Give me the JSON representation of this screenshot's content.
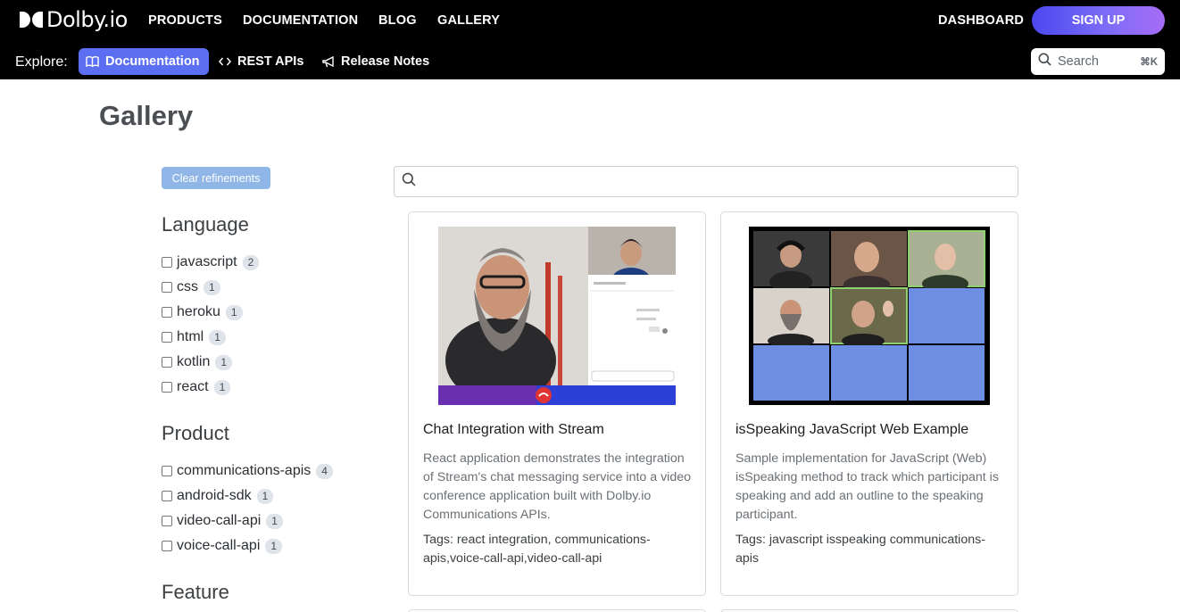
{
  "brand": {
    "name": "Dolby.io"
  },
  "topnav": {
    "links": [
      {
        "label": "PRODUCTS"
      },
      {
        "label": "DOCUMENTATION"
      },
      {
        "label": "BLOG"
      },
      {
        "label": "GALLERY"
      }
    ],
    "dashboard": "DASHBOARD",
    "signup": "SIGN UP"
  },
  "subnav": {
    "explore_label": "Explore:",
    "items": [
      {
        "label": "Documentation",
        "icon": "book-icon"
      },
      {
        "label": "REST APIs",
        "icon": "code-icon"
      },
      {
        "label": "Release Notes",
        "icon": "megaphone-icon"
      }
    ],
    "search": {
      "label": "Search",
      "shortcut": "⌘K"
    }
  },
  "page": {
    "title": "Gallery"
  },
  "filters": {
    "clear_label": "Clear refinements",
    "facets": [
      {
        "title": "Language",
        "items": [
          {
            "label": "javascript",
            "count": "2"
          },
          {
            "label": "css",
            "count": "1"
          },
          {
            "label": "heroku",
            "count": "1"
          },
          {
            "label": "html",
            "count": "1"
          },
          {
            "label": "kotlin",
            "count": "1"
          },
          {
            "label": "react",
            "count": "1"
          }
        ]
      },
      {
        "title": "Product",
        "items": [
          {
            "label": "communications-apis",
            "count": "4"
          },
          {
            "label": "android-sdk",
            "count": "1"
          },
          {
            "label": "video-call-api",
            "count": "1"
          },
          {
            "label": "voice-call-api",
            "count": "1"
          }
        ]
      },
      {
        "title": "Feature",
        "items": []
      }
    ]
  },
  "gallery_search": {
    "value": "",
    "placeholder": ""
  },
  "cards": [
    {
      "title": "Chat Integration with Stream",
      "description": "React application demonstrates the integration of Stream's chat messaging service into a video conference application built with Dolby.io Communications APIs.",
      "tags": "Tags: react integration, communications-apis,voice-call-api,video-call-api"
    },
    {
      "title": "isSpeaking JavaScript Web Example",
      "description": "Sample implementation for JavaScript (Web) isSpeaking method to track which participant is speaking and add an outline to the speaking participant.",
      "tags": "Tags: javascript isspeaking communications-apis"
    }
  ],
  "colors": {
    "accent": "#5c6ef1",
    "signup_start": "#4b48ef",
    "signup_end": "#a66cf6",
    "clear_button": "#8fb6e6"
  }
}
